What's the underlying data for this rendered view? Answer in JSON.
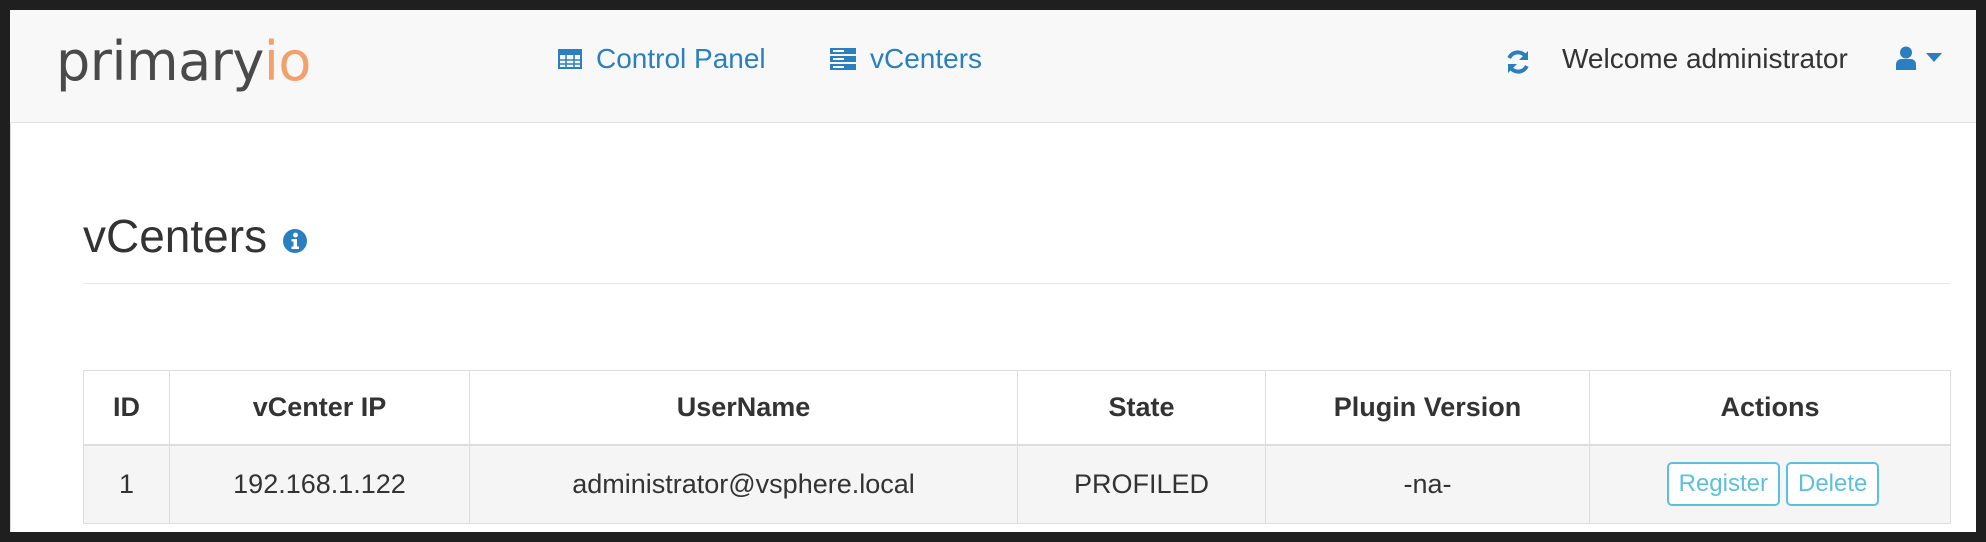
{
  "brand": {
    "part1": "primary",
    "part2": "io",
    "accent": "#f2a16b"
  },
  "nav": {
    "control_panel": {
      "label": "Control Panel",
      "icon": "table-icon"
    },
    "vcenters": {
      "label": "vCenters",
      "icon": "server-icon"
    },
    "refresh_icon": "refresh-icon",
    "welcome_text": "Welcome administrator",
    "user_icon": "user-icon"
  },
  "page": {
    "title": "vCenters",
    "info_icon": "info-icon"
  },
  "table": {
    "headers": {
      "id": "ID",
      "ip": "vCenter IP",
      "user": "UserName",
      "state": "State",
      "plugin": "Plugin Version",
      "actions": "Actions"
    },
    "rows": [
      {
        "id": "1",
        "ip": "192.168.1.122",
        "user": "administrator@vsphere.local",
        "state": "PROFILED",
        "plugin": "-na-",
        "register": "Register",
        "delete": "Delete"
      }
    ]
  },
  "colors": {
    "link": "#2a7fc0",
    "button_info": "#5bc0de"
  }
}
